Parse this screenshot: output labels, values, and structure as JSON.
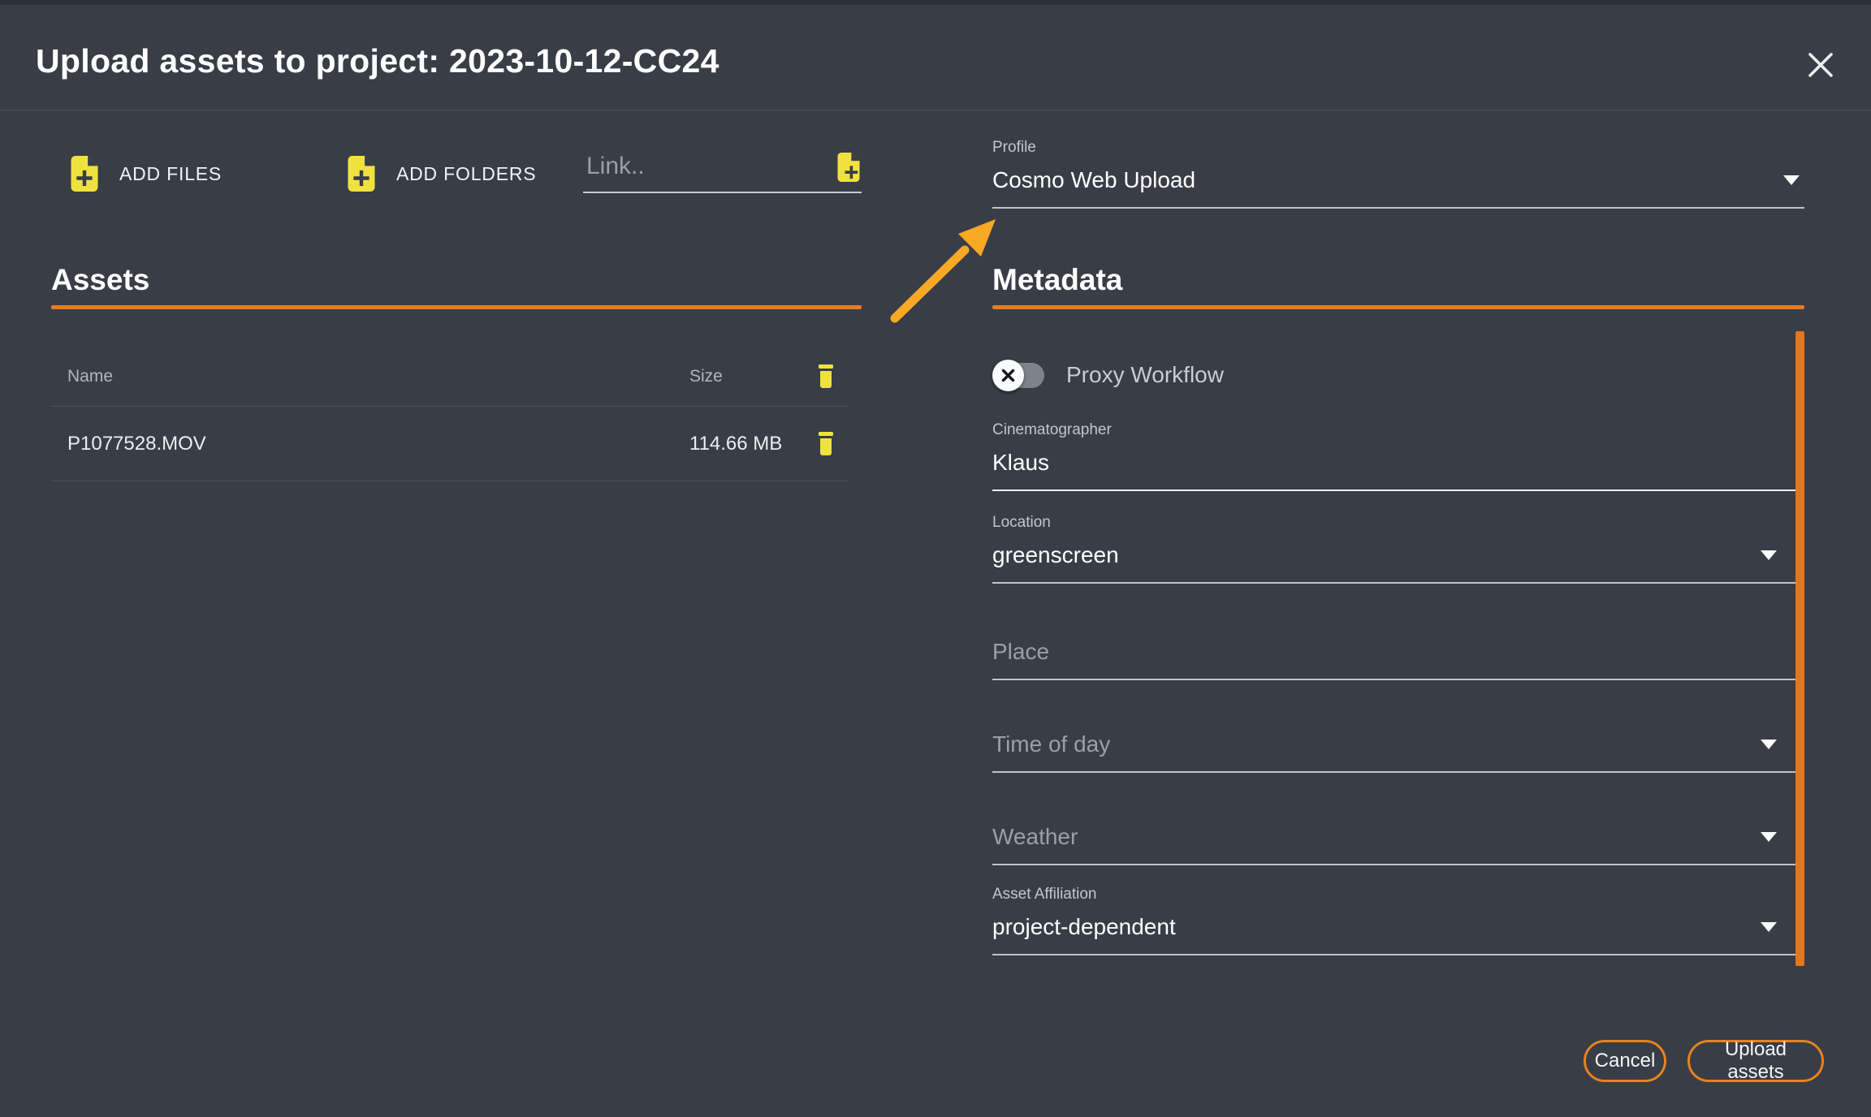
{
  "dialog": {
    "title": "Upload assets to project: 2023-10-12-CC24"
  },
  "toolbar": {
    "add_files_label": "ADD FILES",
    "add_folders_label": "ADD FOLDERS",
    "link_placeholder": "Link.."
  },
  "profile": {
    "label": "Profile",
    "value": "Cosmo Web Upload"
  },
  "assets": {
    "heading": "Assets",
    "columns": {
      "name": "Name",
      "size": "Size"
    },
    "rows": [
      {
        "name": "P1077528.MOV",
        "size": "114.66 MB"
      }
    ]
  },
  "metadata": {
    "heading": "Metadata",
    "proxy_workflow": {
      "label": "Proxy Workflow",
      "enabled": false
    },
    "fields": [
      {
        "label": "Cinematographer",
        "value": "Klaus",
        "type": "text"
      },
      {
        "label": "Location",
        "value": "greenscreen",
        "type": "select"
      },
      {
        "placeholder": "Place",
        "type": "text"
      },
      {
        "placeholder": "Time of day",
        "type": "select"
      },
      {
        "placeholder": "Weather",
        "type": "select"
      },
      {
        "label": "Asset Affiliation",
        "value": "project-dependent",
        "type": "select"
      }
    ]
  },
  "footer": {
    "cancel_label": "Cancel",
    "upload_label": "Upload assets"
  },
  "colors": {
    "background": "#383d46",
    "accent_orange": "#e87d1e",
    "arrow_amber": "#f9a825",
    "icon_yellow": "#f0e23e",
    "text_white": "#ffffff",
    "label_gray": "#c3c7cc",
    "placeholder_gray": "#9ba0a6"
  }
}
